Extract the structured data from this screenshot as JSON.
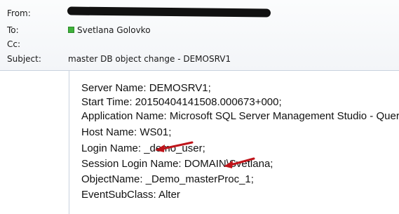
{
  "header": {
    "from_label": "From:",
    "to_label": "To:",
    "to_value": "Svetlana Golovko",
    "cc_label": "Cc:",
    "subject_label": "Subject:",
    "subject_value": "master DB object change - DEMOSRV1"
  },
  "body_lines": [
    "Server Name: DEMOSRV1;",
    "Start Time: 20150404141508.000673+000;",
    "Application Name: Microsoft SQL Server Management Studio - Query;",
    "Host Name: WS01;",
    "Login Name: _demo_user;",
    "Session Login Name: DOMAIN\\Svetlana;",
    "ObjectName: _Demo_masterProc_1;",
    "EventSubClass: Alter"
  ],
  "colors": {
    "arrow": "#c0151b",
    "presence": "#3fb23a"
  },
  "icons": [
    "presence-icon",
    "arrow-icon"
  ]
}
